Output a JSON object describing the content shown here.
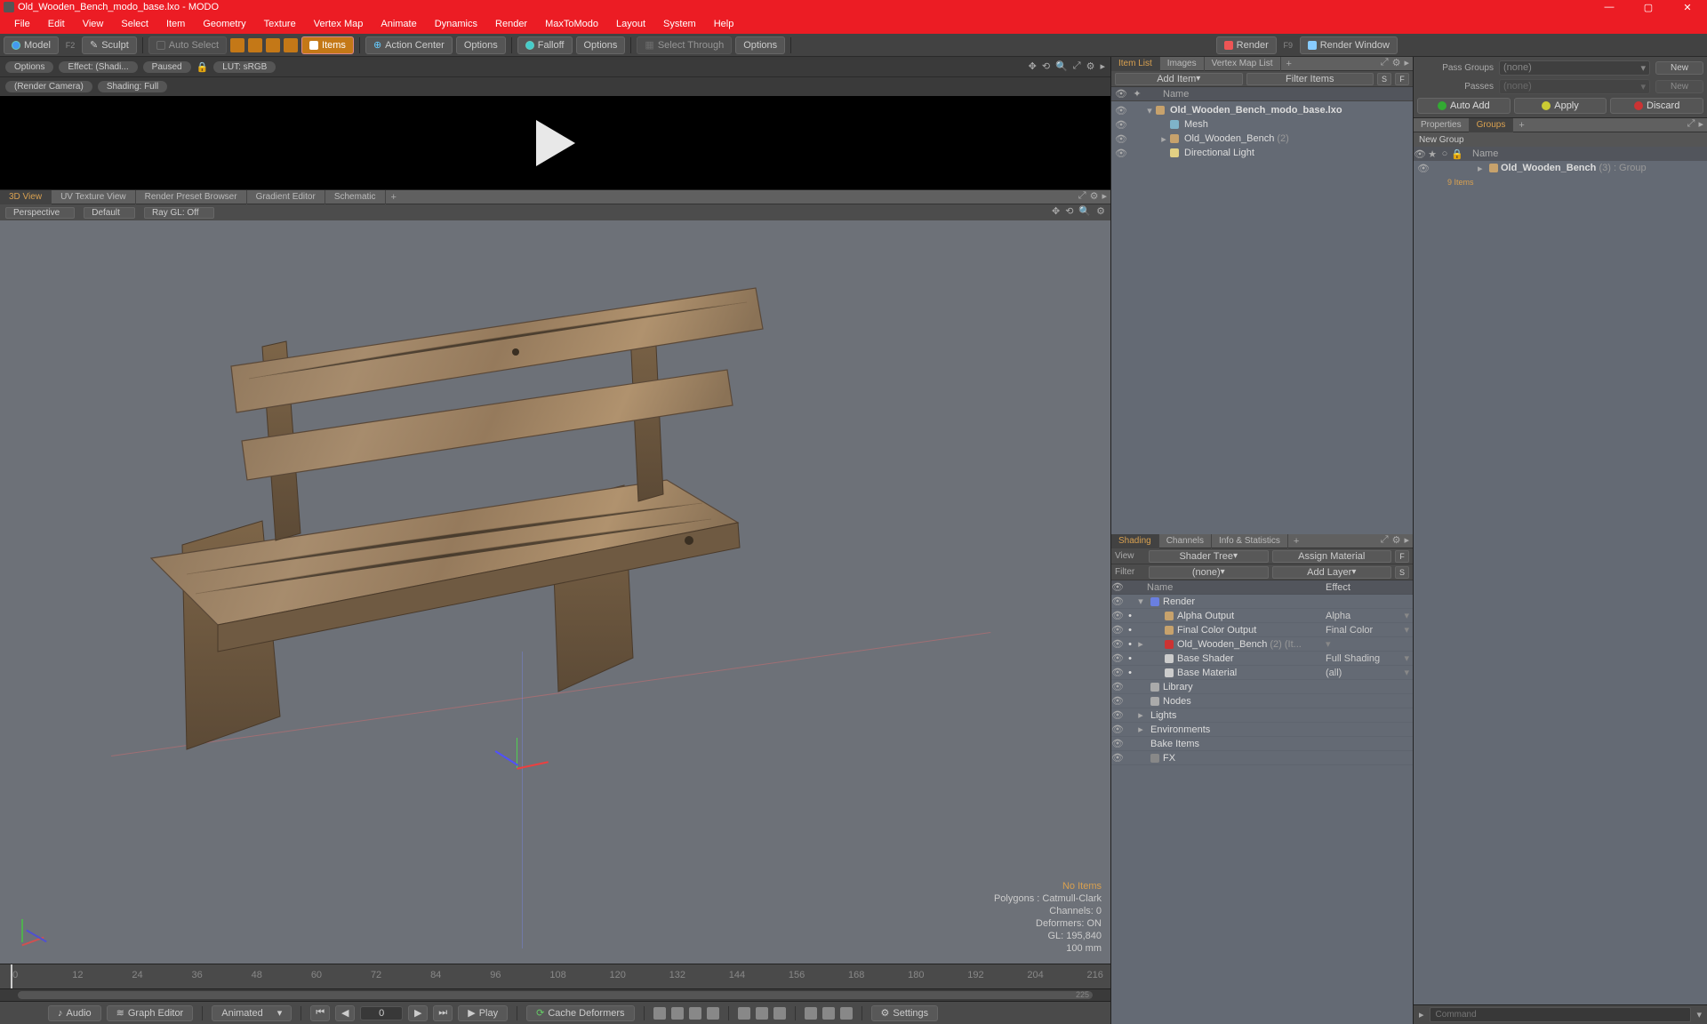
{
  "app": {
    "title": "Old_Wooden_Bench_modo_base.lxo - MODO"
  },
  "menubar": [
    "File",
    "Edit",
    "View",
    "Select",
    "Item",
    "Geometry",
    "Texture",
    "Vertex Map",
    "Animate",
    "Dynamics",
    "Render",
    "MaxToModo",
    "Layout",
    "System",
    "Help"
  ],
  "toolbar": {
    "model": "Model",
    "sculpt": "Sculpt",
    "auto_select": "Auto Select",
    "items": "Items",
    "action_center": "Action Center",
    "options1": "Options",
    "falloff": "Falloff",
    "options2": "Options",
    "select_through": "Select Through",
    "options3": "Options",
    "render": "Render",
    "render_window": "Render Window"
  },
  "preview": {
    "options": "Options",
    "effect": "Effect: (Shadi...",
    "paused": "Paused",
    "lut": "LUT: sRGB",
    "camera": "(Render Camera)",
    "shading": "Shading: Full"
  },
  "viewtabs": [
    "3D View",
    "UV Texture View",
    "Render Preset Browser",
    "Gradient Editor",
    "Schematic"
  ],
  "viewdrops": {
    "persp": "Perspective",
    "default": "Default",
    "raygl": "Ray GL: Off"
  },
  "viewport_stats": {
    "no_items": "No Items",
    "polys": "Polygons : Catmull-Clark",
    "channels": "Channels: 0",
    "deformers": "Deformers: ON",
    "gl": "GL: 195,840",
    "size": "100 mm"
  },
  "timeline": {
    "ticks": [
      "0",
      "12",
      "24",
      "36",
      "48",
      "60",
      "72",
      "84",
      "96",
      "108",
      "120",
      "132",
      "144",
      "156",
      "168",
      "180",
      "192",
      "204",
      "216"
    ],
    "rangeA": "0",
    "rangeB": "225"
  },
  "bottom": {
    "audio": "Audio",
    "graph": "Graph Editor",
    "anim": "Animated",
    "play": "Play",
    "frame": "0",
    "cache": "Cache Deformers",
    "settings": "Settings"
  },
  "itemlist": {
    "tabs": [
      "Item List",
      "Images",
      "Vertex Map List"
    ],
    "add_item": "Add Item",
    "filter": "Filter Items",
    "s": "S",
    "f": "F",
    "header_name": "Name",
    "rows": [
      {
        "indent": 0,
        "expand": "▾",
        "label": "Old_Wooden_Bench_modo_base.lxo",
        "bold": true,
        "icon": "#c7a26c"
      },
      {
        "indent": 1,
        "expand": "",
        "label": "Mesh",
        "icon": "#7fb3c9"
      },
      {
        "indent": 1,
        "expand": "▸",
        "label": "Old_Wooden_Bench",
        "suffix": "(2)",
        "icon": "#c7a26c"
      },
      {
        "indent": 1,
        "expand": "",
        "label": "Directional Light",
        "icon": "#e2d084"
      }
    ]
  },
  "shading": {
    "tabs": [
      "Shading",
      "Channels",
      "Info & Statistics"
    ],
    "view_label": "View",
    "view_val": "Shader Tree",
    "assign": "Assign Material",
    "f": "F",
    "filter_label": "Filter",
    "filter_val": "(none)",
    "addlayer": "Add Layer",
    "s": "S",
    "col_name": "Name",
    "col_effect": "Effect",
    "rows": [
      {
        "tw": "▾",
        "name": "Render",
        "eff": "",
        "ic": "#6a7fe0",
        "depth": 0
      },
      {
        "tw": "",
        "name": "Alpha Output",
        "eff": "Alpha",
        "ic": "#c7a26c",
        "depth": 1,
        "dd": true
      },
      {
        "tw": "",
        "name": "Final Color Output",
        "eff": "Final Color",
        "ic": "#c7a26c",
        "depth": 1,
        "dd": true
      },
      {
        "tw": "▸",
        "name": "Old_Wooden_Bench",
        "suffix": "(2) (It...",
        "eff": "",
        "ic": "#c33",
        "depth": 1,
        "dd": true
      },
      {
        "tw": "",
        "name": "Base Shader",
        "eff": "Full Shading",
        "ic": "#ccc",
        "depth": 1,
        "dd": true
      },
      {
        "tw": "",
        "name": "Base Material",
        "eff": "(all)",
        "ic": "#ccc",
        "depth": 1,
        "dd": true
      },
      {
        "tw": "",
        "name": "Library",
        "eff": "",
        "ic": "#aaa",
        "depth": 0,
        "folder": true
      },
      {
        "tw": "",
        "name": "Nodes",
        "eff": "",
        "ic": "#aaa",
        "depth": 0,
        "folder": true
      },
      {
        "tw": "▸",
        "name": "Lights",
        "eff": "",
        "ic": "",
        "depth": 0
      },
      {
        "tw": "▸",
        "name": "Environments",
        "eff": "",
        "ic": "",
        "depth": 0
      },
      {
        "tw": "",
        "name": "Bake Items",
        "eff": "",
        "ic": "",
        "depth": 0
      },
      {
        "tw": "",
        "name": "FX",
        "eff": "",
        "ic": "#888",
        "depth": 0,
        "folder": true
      }
    ]
  },
  "passes": {
    "groups_label": "Pass Groups",
    "groups_val": "(none)",
    "new": "New",
    "passes_label": "Passes",
    "passes_val": "(none)",
    "new2": "New",
    "auto": "Auto Add",
    "apply": "Apply",
    "discard": "Discard"
  },
  "groups_panel": {
    "tabs": [
      "Properties",
      "Groups"
    ],
    "new_group": "New Group",
    "header_name": "Name",
    "item": "Old_Wooden_Bench",
    "item_suffix": "(3) : Group",
    "count": "9 Items"
  },
  "cmd": {
    "label": "Command"
  }
}
